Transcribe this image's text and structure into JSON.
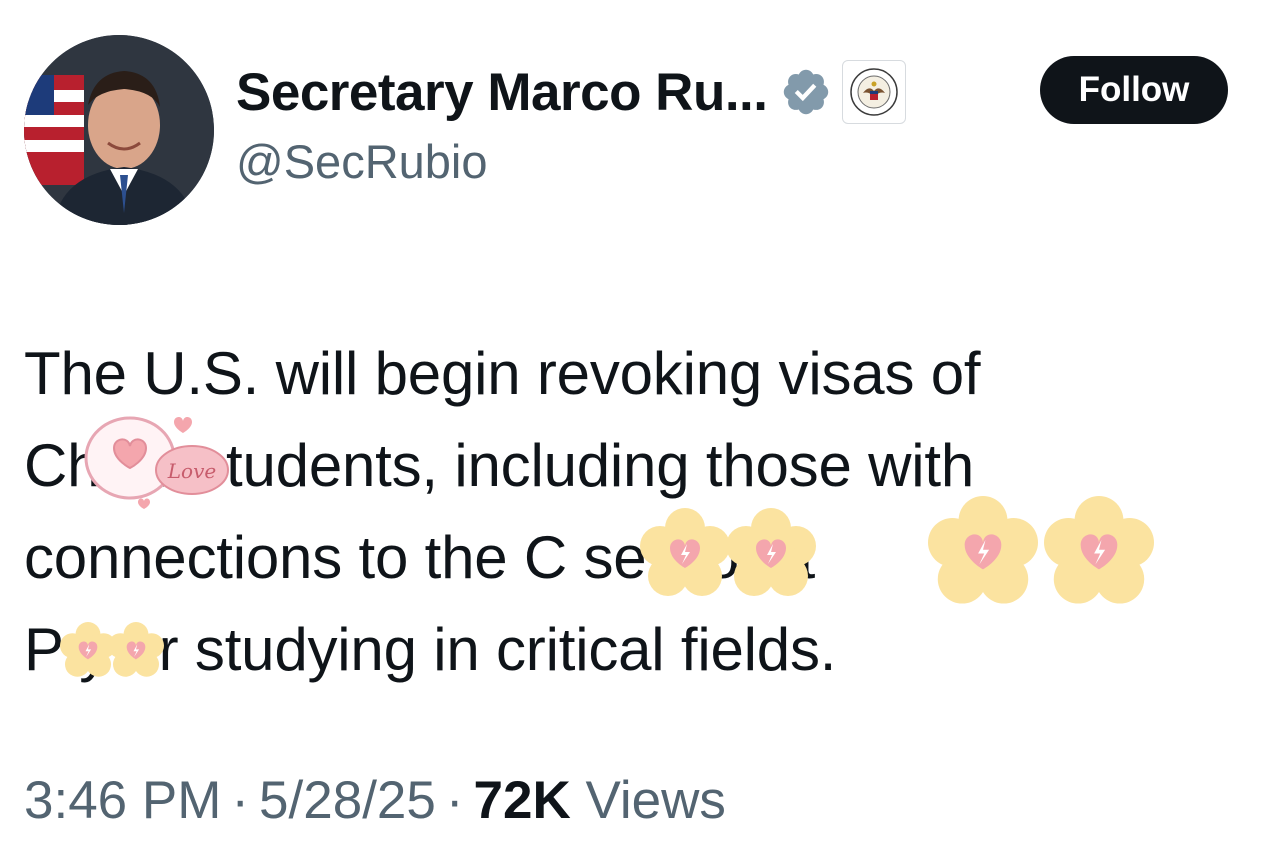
{
  "author": {
    "display_name": "Secretary Marco Ru...",
    "handle": "@SecRubio",
    "verified_icon": "verified-checkmark-icon",
    "affiliate_badge_icon": "department-of-state-seal-icon"
  },
  "actions": {
    "follow_label": "Follow"
  },
  "tweet": {
    "text": "The U.S. will begin revoking visas of\nCh    se students, including those with\nconnections to the C        se Co       ist\nP    y or studying in critical fields.",
    "stickers": [
      "heart-love-sticker",
      "flower-heart-sticker"
    ],
    "sticker_text": "Love"
  },
  "meta": {
    "time": "3:46 PM",
    "separator": "·",
    "date": "5/28/25",
    "views_count": "72K",
    "views_label": "Views"
  },
  "colors": {
    "text_primary": "#0f1419",
    "text_secondary": "#536471",
    "verified_badge": "#829aab",
    "follow_bg": "#0f1419",
    "sticker_flower": "#fbe3a0",
    "sticker_heart": "#f4a6ad"
  }
}
